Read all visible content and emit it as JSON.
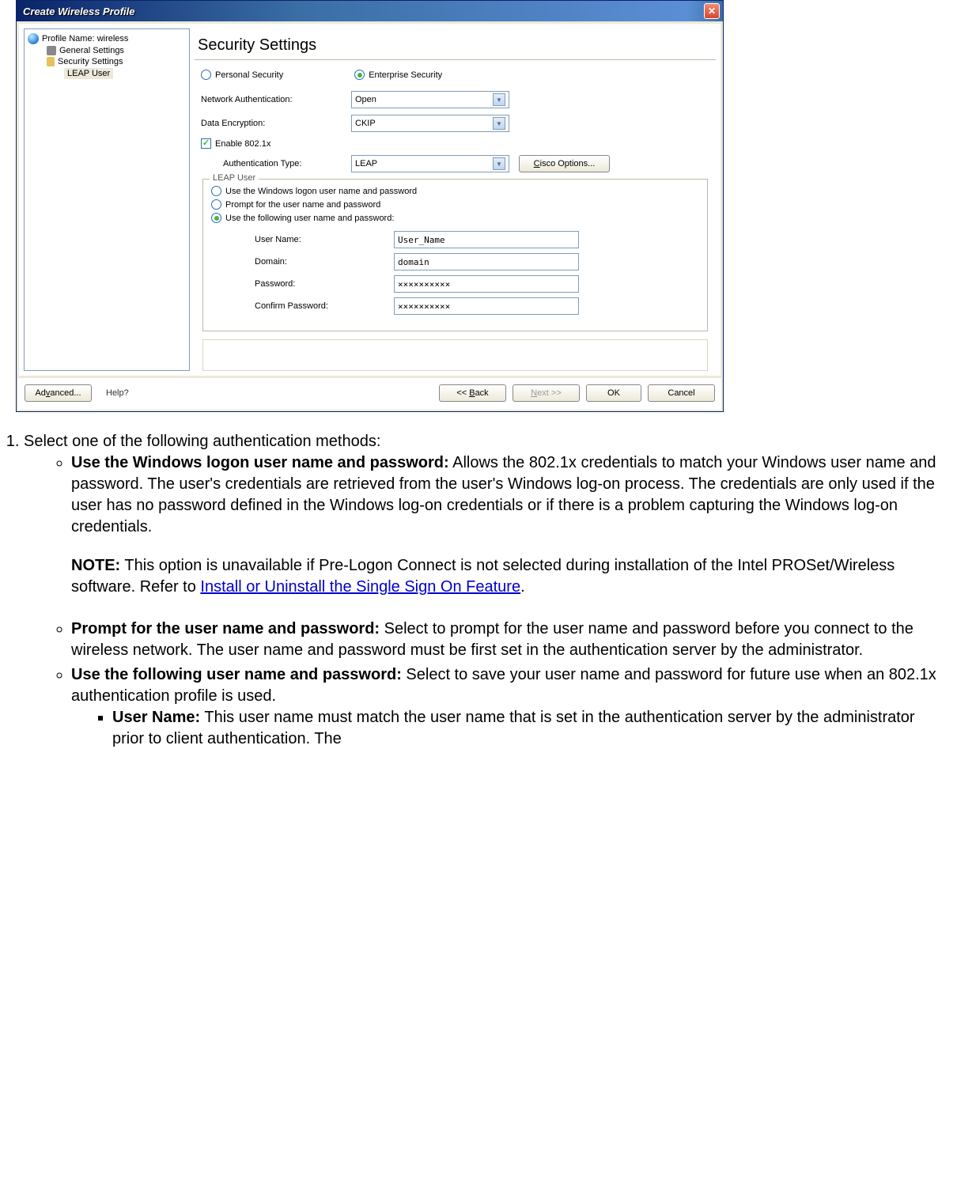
{
  "window": {
    "title": "Create Wireless Profile"
  },
  "sidebar": {
    "profile_label": "Profile Name: wireless",
    "general_settings": "General Settings",
    "security_settings": "Security Settings",
    "leap_user": "LEAP User"
  },
  "main": {
    "heading": "Security Settings",
    "personal_security": "Personal Security",
    "enterprise_security": "Enterprise Security",
    "network_auth_label": "Network Authentication:",
    "network_auth_value": "Open",
    "data_encryption_label": "Data Encryption:",
    "data_encryption_value": "CKIP",
    "enable_8021x": "Enable 802.1x",
    "auth_type_label": "Authentication Type:",
    "auth_type_value": "LEAP",
    "cisco_options": "Cisco Options...",
    "leap_fieldset": "LEAP User",
    "opt_windows": "Use the Windows logon user name and password",
    "opt_prompt": "Prompt for the user name and password",
    "opt_following": "Use the following user name and password:",
    "user_name_label": "User Name:",
    "user_name_value": "User_Name",
    "domain_label": "Domain:",
    "domain_value": "domain",
    "password_label": "Password:",
    "password_value": "××××××××××",
    "confirm_label": "Confirm Password:",
    "confirm_value": "××××××××××"
  },
  "buttons": {
    "advanced": "Advanced...",
    "help": "Help?",
    "back": "<< Back",
    "next": "Next >>",
    "ok": "OK",
    "cancel": "Cancel"
  },
  "instructions": {
    "step1": "Select one of the following authentication methods:",
    "opt1_bold": "Use the Windows logon user name and password:",
    "opt1_text": " Allows the 802.1x credentials to match your Windows user name and password. The user's credentials are retrieved from the user's Windows log-on process. The credentials are only used if the user has no password defined in the Windows log-on credentials or if there is a problem capturing the Windows log-on credentials.",
    "note_bold": "NOTE:",
    "note_text": " This option is unavailable if Pre-Logon Connect is not selected during installation of the Intel PROSet/Wireless software. Refer to ",
    "note_link": "Install or Uninstall the Single Sign On Feature",
    "opt2_bold": "Prompt for the user name and password:",
    "opt2_text": " Select to prompt for the user name and password before you connect to the wireless network. The user name and password must be first set in the authentication server by the administrator.",
    "opt3_bold": "Use the following user name and password:",
    "opt3_text": " Select to save your user name and password for future use when an 802.1x authentication profile is used.",
    "sub_user_bold": "User Name:",
    "sub_user_text": " This user name must match the user name that is set in the authentication server by the administrator prior to client authentication. The"
  }
}
